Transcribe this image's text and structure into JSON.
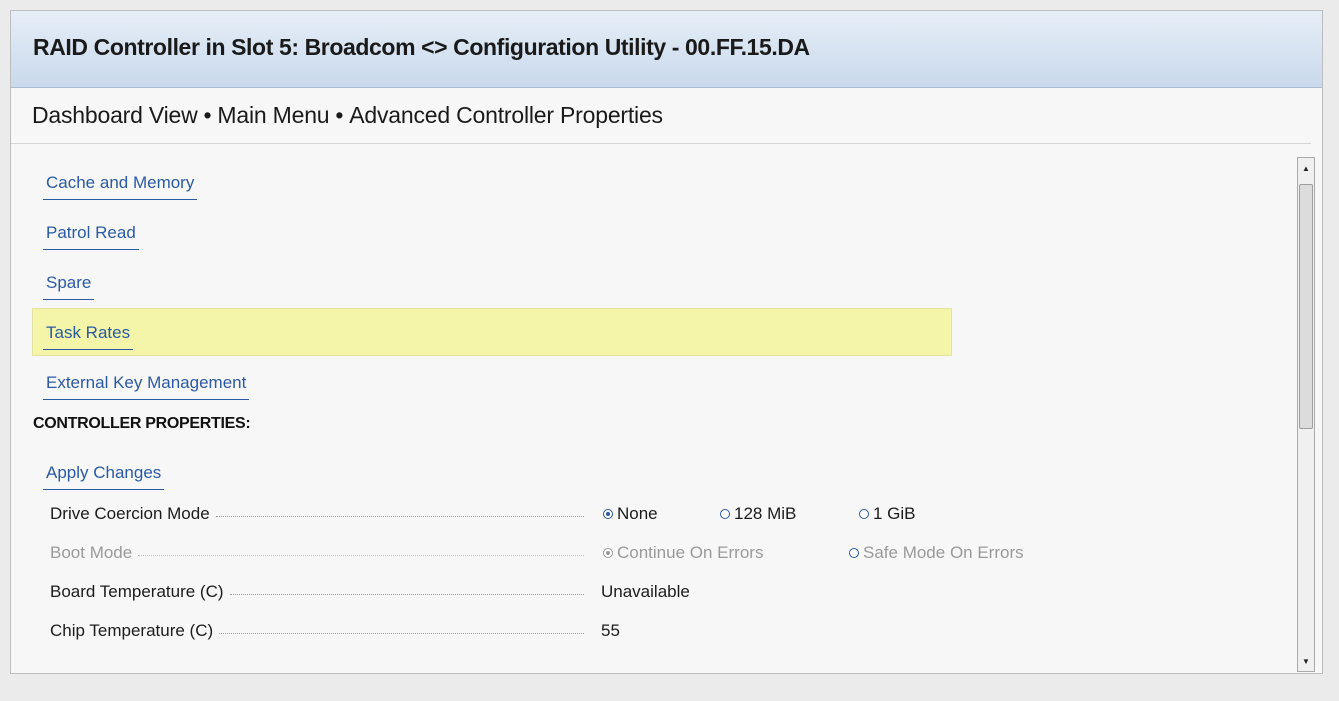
{
  "window": {
    "title": "RAID Controller in Slot 5: Broadcom <> Configuration Utility - 00.FF.15.DA"
  },
  "breadcrumb": {
    "items": [
      "Dashboard View",
      "Main Menu",
      "Advanced Controller Properties"
    ],
    "separator": "•"
  },
  "menu_links": [
    {
      "label": "Cache and Memory"
    },
    {
      "label": "Patrol Read"
    },
    {
      "label": "Spare"
    },
    {
      "label": "Task Rates",
      "highlighted": true
    },
    {
      "label": "External Key Management"
    }
  ],
  "section": {
    "heading": "CONTROLLER PROPERTIES:",
    "apply_changes": "Apply Changes"
  },
  "properties": [
    {
      "label": "Drive Coercion Mode",
      "type": "radio",
      "options": [
        "None",
        "128 MiB",
        "1 GiB"
      ],
      "selected": "None",
      "enabled": true
    },
    {
      "label": "Boot Mode",
      "type": "radio",
      "options": [
        "Continue On Errors",
        "Safe Mode On Errors"
      ],
      "selected": "Continue On Errors",
      "enabled": false
    },
    {
      "label": "Board Temperature (C)",
      "type": "text",
      "value": "Unavailable",
      "enabled": true
    },
    {
      "label": "Chip Temperature (C)",
      "type": "text",
      "value": "55",
      "enabled": true
    }
  ],
  "colors": {
    "link": "#2a5aa3",
    "highlight": "#f4f5a8",
    "title_bar": "#c9d9ec",
    "disabled_text": "#9a9a9a"
  },
  "icons": {
    "scroll_up": "triangle-up-icon",
    "scroll_down": "triangle-down-icon"
  }
}
